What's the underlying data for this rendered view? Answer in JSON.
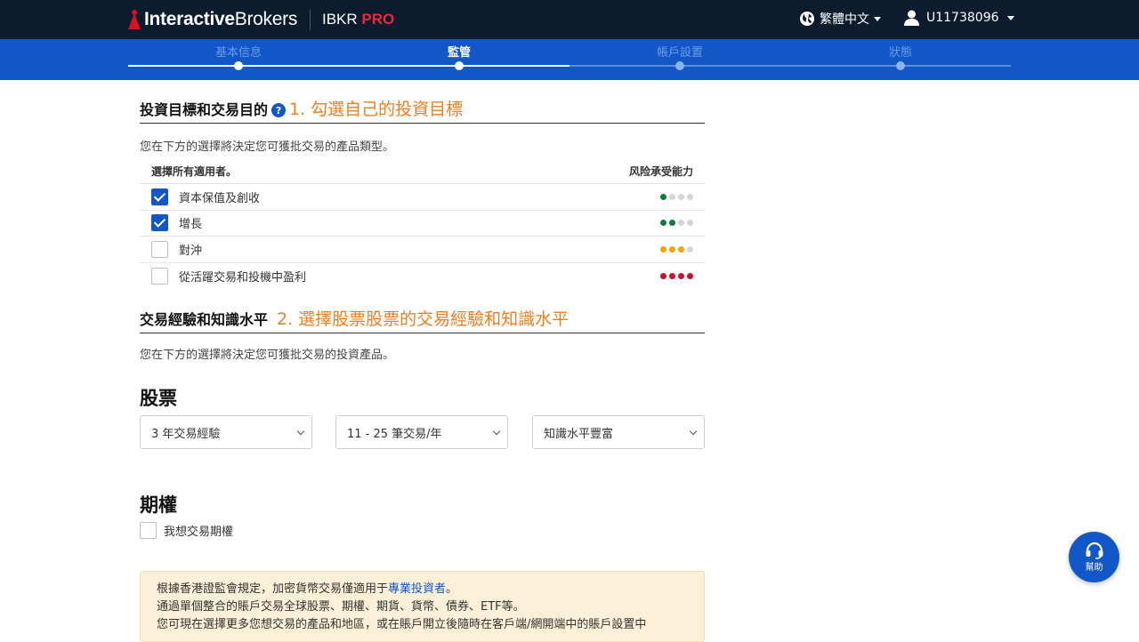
{
  "header": {
    "brand_prefix": "Interactive",
    "brand_suffix": "Brokers",
    "product_name": "IBKR",
    "product_tier": "PRO",
    "language": "繁體中文",
    "user_id": "U11738096"
  },
  "stepper": {
    "steps": [
      {
        "label": "基本信息",
        "state": "done"
      },
      {
        "label": "監管",
        "state": "active"
      },
      {
        "label": "帳戶設置",
        "state": "todo"
      },
      {
        "label": "狀態",
        "state": "todo"
      }
    ]
  },
  "objectives": {
    "title": "投資目標和交易目的",
    "help_icon": "question-circle-icon",
    "annotation": "1. 勾選自己的投資目標",
    "description": "您在下方的選擇將決定您可獲批交易的產品類型。",
    "select_all_header": "選擇所有適用者。",
    "risk_header": "风险承受能力",
    "items": [
      {
        "label": "資本保值及創收",
        "checked": true,
        "risk": 1,
        "risk_color": "#0f7a3c"
      },
      {
        "label": "增長",
        "checked": true,
        "risk": 2,
        "risk_color": "#0f7a3c"
      },
      {
        "label": "對沖",
        "checked": false,
        "risk": 3,
        "risk_color": "#f2a400"
      },
      {
        "label": "從活躍交易和投機中盈利",
        "checked": false,
        "risk": 4,
        "risk_color": "#c8102e"
      }
    ]
  },
  "experience": {
    "title": "交易經驗和知識水平",
    "annotation": "2. 選擇股票股票的交易經驗和知識水平",
    "description": "您在下方的選擇將決定您可獲批交易的投資產品。"
  },
  "stocks": {
    "title": "股票",
    "experience_select": "3 年交易經驗",
    "frequency_select": "11 - 25 筆交易/年",
    "knowledge_select": "知識水平豐富"
  },
  "options": {
    "title": "期權",
    "checkbox_label": "我想交易期權",
    "checked": false
  },
  "notice": {
    "line1_before": "根據香港證監會規定，加密貨幣交易僅適用于",
    "line1_link": "專業投資者",
    "line1_after": "。",
    "line2": "通過單個整合的賬戶交易全球股票、期權、期貨、貨幣、債券、ETF等。",
    "line3": "您可現在選擇更多您想交易的產品和地區，或在賬戶開立後隨時在客戶端/網開端中的賬戶設置中"
  },
  "help_button": {
    "label": "幫助",
    "icon": "headset-icon"
  },
  "colors": {
    "nav_bg": "#0d1b2e",
    "stepper_bg": "#1157c8",
    "accent": "#1157c8",
    "annotation": "#f07d1e",
    "brand_red": "#d81222",
    "notice_bg": "#fcf0d8"
  }
}
